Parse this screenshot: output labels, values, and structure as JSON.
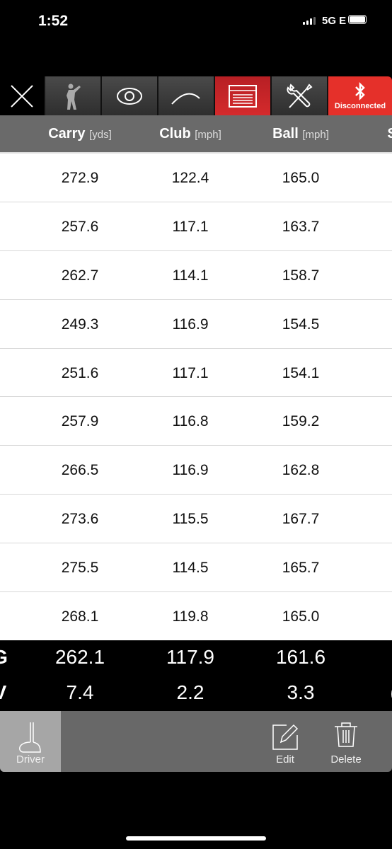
{
  "status": {
    "time": "1:52",
    "network": "5G E"
  },
  "nav": {
    "tabs": [
      {
        "icon": "close-icon"
      },
      {
        "icon": "golfer-icon"
      },
      {
        "icon": "eye-icon"
      },
      {
        "icon": "trajectory-icon"
      },
      {
        "icon": "table-icon",
        "active": true
      },
      {
        "icon": "tools-icon"
      },
      {
        "icon": "bluetooth-icon",
        "label": "Disconnected"
      }
    ]
  },
  "header": {
    "columns": [
      {
        "name": "Carry",
        "unit": "[yds]"
      },
      {
        "name": "Club",
        "unit": "[mph]"
      },
      {
        "name": "Ball",
        "unit": "[mph]"
      },
      {
        "name": "S",
        "unit": ""
      }
    ]
  },
  "rows": [
    [
      "272.9",
      "122.4",
      "165.0"
    ],
    [
      "257.6",
      "117.1",
      "163.7"
    ],
    [
      "262.7",
      "114.1",
      "158.7"
    ],
    [
      "249.3",
      "116.9",
      "154.5"
    ],
    [
      "251.6",
      "117.1",
      "154.1"
    ],
    [
      "257.9",
      "116.8",
      "159.2"
    ],
    [
      "266.5",
      "116.9",
      "162.8"
    ],
    [
      "273.6",
      "115.5",
      "167.7"
    ],
    [
      "275.5",
      "114.5",
      "165.7"
    ],
    [
      "268.1",
      "119.8",
      "165.0"
    ]
  ],
  "summary": [
    {
      "label": "G",
      "values": [
        "262.1",
        "117.9",
        "161.6"
      ],
      "trail": ""
    },
    {
      "label": "V",
      "values": [
        "7.4",
        "2.2",
        "3.3"
      ],
      "trail": "("
    }
  ],
  "toolbar": {
    "club": "Driver",
    "edit": "Edit",
    "delete": "Delete"
  },
  "colors": {
    "accent": "#d42a2c",
    "disconnected": "#e5302a",
    "header": "#6a6a6a"
  }
}
